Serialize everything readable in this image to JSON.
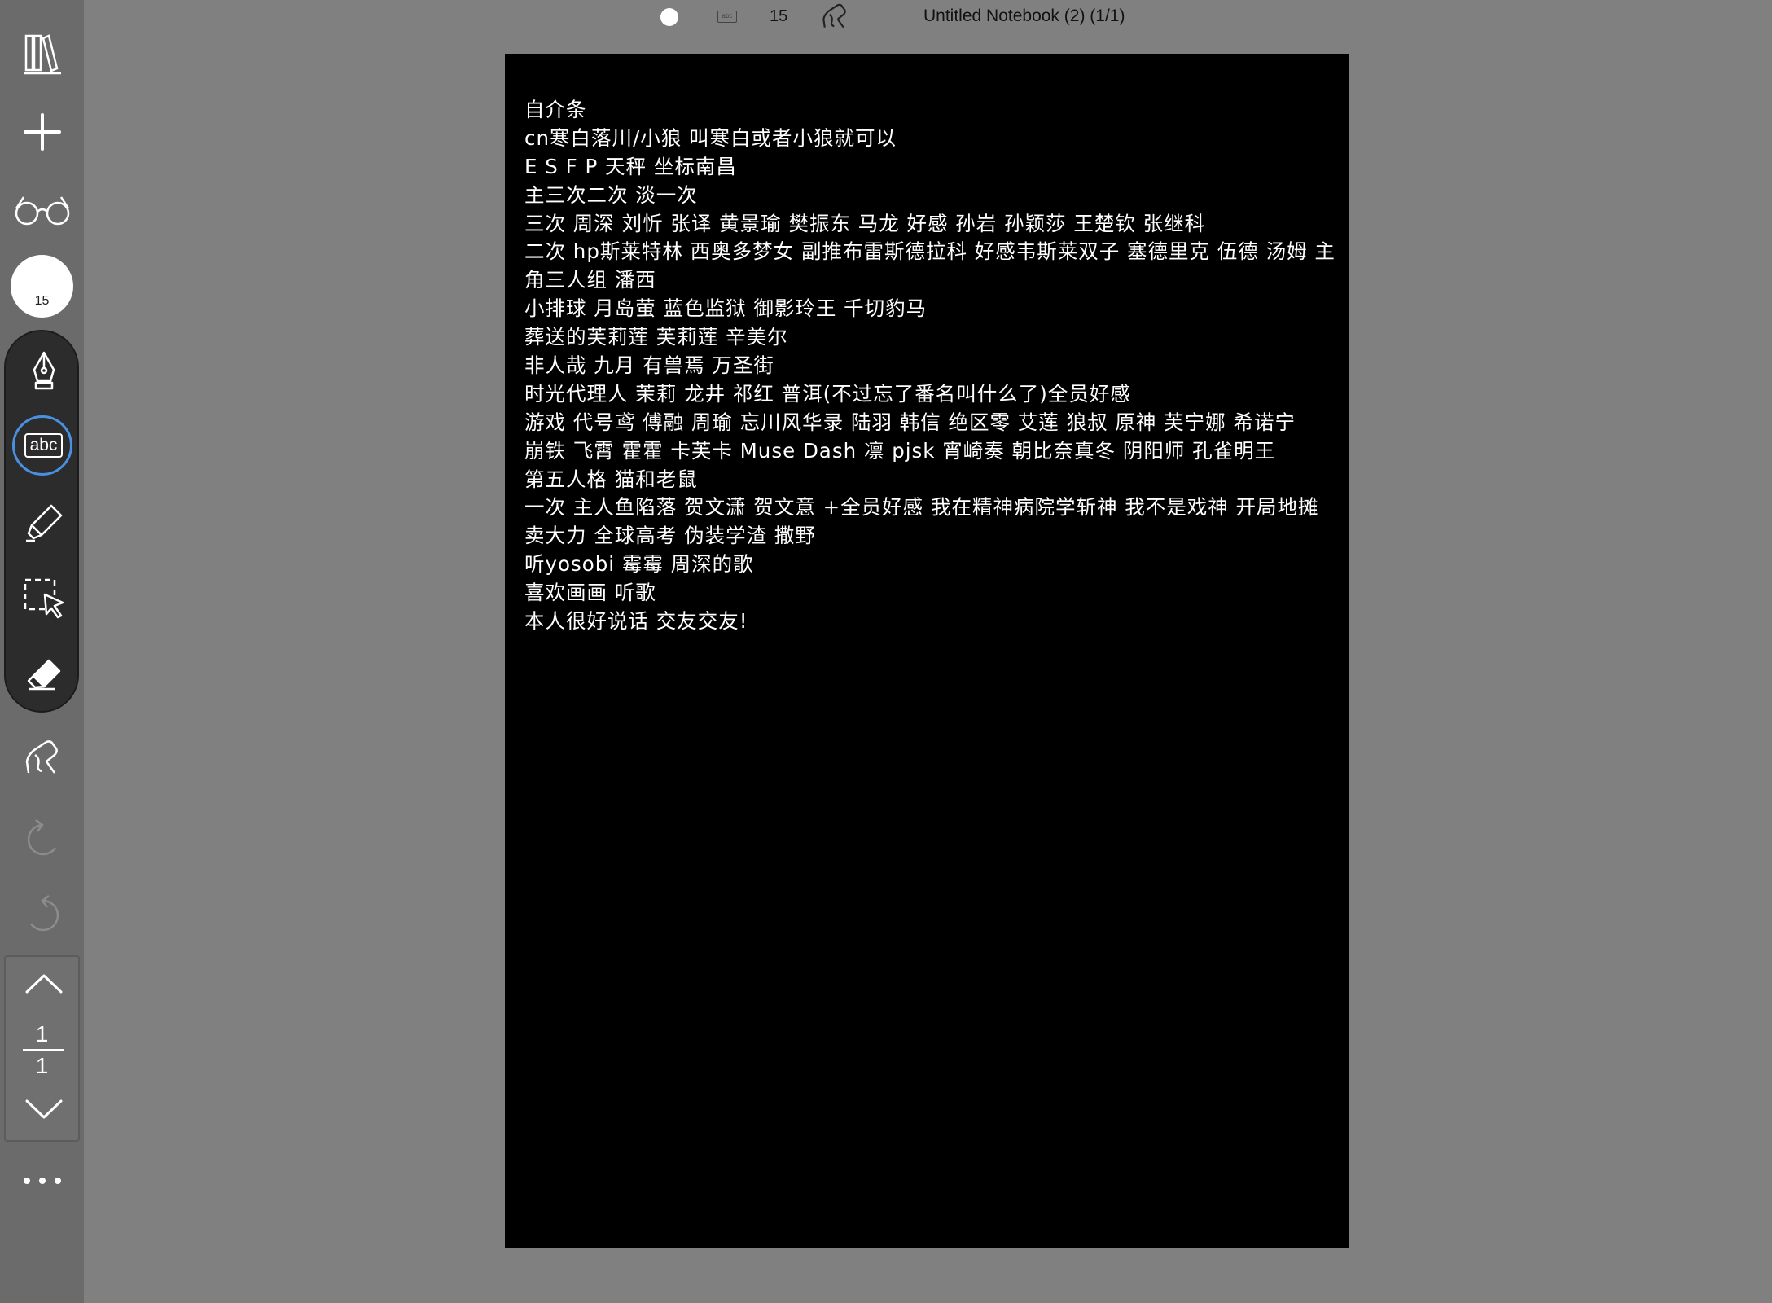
{
  "topbar": {
    "text_size": "15",
    "title": "Untitled Notebook (2) (1/1)",
    "text_tool_label": "abc"
  },
  "sidebar": {
    "pen_size": "15",
    "text_tool_label": "abc",
    "accent": "#4a90e2"
  },
  "icons": [
    "library-icon",
    "add-icon",
    "glasses-icon",
    "pen-icon",
    "text-icon",
    "highlighter-icon",
    "lasso-select-icon",
    "eraser-icon",
    "hand-pen-icon",
    "undo-icon",
    "redo-icon",
    "chevron-up-icon",
    "chevron-down-icon",
    "more-icon"
  ],
  "pager": {
    "current": "1",
    "total": "1"
  },
  "page": {
    "lines": [
      "自介条",
      "cn寒白落川/小狼  叫寒白或者小狼就可以",
      "E S F P  天秤  坐标南昌",
      "主三次二次 淡一次",
      "三次 周深 刘忻 张译 黄景瑜 樊振东 马龙  好感 孙岩 孙颖莎 王楚钦 张继科",
      "二次 hp斯莱特林 西奥多梦女 副推布雷斯德拉科 好感韦斯莱双子 塞德里克 伍德 汤姆 主",
      "角三人组 潘西",
      "小排球 月岛萤    蓝色监狱 御影玲王 千切豹马",
      "葬送的芙莉莲 芙莉莲 辛美尔",
      "非人哉 九月   有兽焉  万圣街",
      "时光代理人   茉莉 龙井 祁红 普洱(不过忘了番名叫什么了)全员好感",
      "游戏 代号鸢 傅融 周瑜     忘川风华录 陆羽 韩信    绝区零 艾莲 狼叔    原神  芙宁娜 希诺宁",
      "崩铁 飞霄 霍霍 卡芙卡  Muse Dash 凛  pjsk  宵崎奏 朝比奈真冬 阴阳师 孔雀明王",
      "第五人格 猫和老鼠",
      "一次 主人鱼陷落 贺文潇 贺文意 +全员好感    我在精神病院学斩神 我不是戏神 开局地摊",
      "卖大力 全球高考 伪装学渣 撒野",
      "听yosobi 霉霉 周深的歌",
      "喜欢画画 听歌",
      "本人很好说话 交友交友!"
    ]
  }
}
